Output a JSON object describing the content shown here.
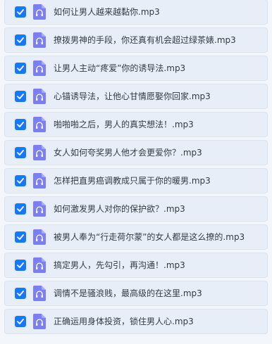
{
  "list": {
    "items": [
      {
        "name": "如何让男人越来越黏你.mp3",
        "checked": true
      },
      {
        "name": "撩拨男神的手段，你还真有机会超过绿茶婊.mp3",
        "checked": true
      },
      {
        "name": "让男人主动“疼爱”你的诱导法.mp3",
        "checked": true
      },
      {
        "name": "心锚诱导法，让他心甘情愿娶你回家.mp3",
        "checked": true
      },
      {
        "name": "啪啪啪之后，男人的真实想法！.mp3",
        "checked": true
      },
      {
        "name": "女人如何夸奖男人他才会更爱你？.mp3",
        "checked": true
      },
      {
        "name": "怎样把直男癌调教成只属于你的暖男.mp3",
        "checked": true
      },
      {
        "name": "如何激发男人对你的保护欲？.mp3",
        "checked": true
      },
      {
        "name": "被男人奉为“行走荷尔蒙”的女人都是这么撩的.mp3",
        "checked": true
      },
      {
        "name": "搞定男人，先勾引，再沟通！.mp3",
        "checked": true
      },
      {
        "name": "调情不是骚浪贱，最高级的在这里.mp3",
        "checked": true
      },
      {
        "name": "正确运用身体投资，锁住男人心.mp3",
        "checked": true
      }
    ],
    "icon": "audio-file-icon",
    "colors": {
      "checkbox": "#1677ff",
      "file_icon": "#7b7ff5",
      "row_bg": "#e8eef7",
      "text": "#333a45"
    }
  }
}
